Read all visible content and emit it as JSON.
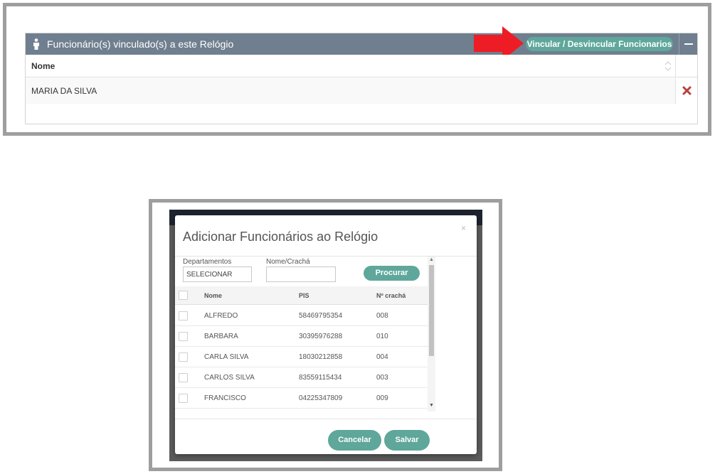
{
  "panel": {
    "title": "Funcionário(s) vinculado(s) a este Relógio",
    "vincular_button": "Vincular / Desvincular Funcionarios",
    "table": {
      "column_name": "Nome",
      "rows": [
        {
          "nome": "MARIA DA SILVA"
        }
      ]
    }
  },
  "modal": {
    "title": "Adicionar Funcionários ao Relógio",
    "close_label": "×",
    "filters": {
      "departamentos_label": "Departamentos",
      "departamentos_value": "SELECIONAR",
      "nome_label": "Nome/Crachá",
      "nome_value": ""
    },
    "procurar_button": "Procurar",
    "grid": {
      "headers": {
        "nome": "Nome",
        "pis": "PIS",
        "cracha": "Nº crachá"
      },
      "rows": [
        {
          "nome": "ALFREDO",
          "pis": "58469795354",
          "cracha": "008"
        },
        {
          "nome": "BARBARA",
          "pis": "30395976288",
          "cracha": "010"
        },
        {
          "nome": "CARLA SILVA",
          "pis": "18030212858",
          "cracha": "004"
        },
        {
          "nome": "CARLOS SILVA",
          "pis": "83559115434",
          "cracha": "003"
        },
        {
          "nome": "FRANCISCO",
          "pis": "04225347809",
          "cracha": "009"
        }
      ]
    },
    "cancelar_button": "Cancelar",
    "salvar_button": "Salvar"
  },
  "colors": {
    "header_bg": "#6f7f8f",
    "accent_teal": "#5fa79a",
    "arrow_red": "#ee1c24",
    "delete_red": "#b8433e"
  },
  "icons": [
    "user-icon",
    "sort-icon",
    "delete-icon",
    "arrow-icon",
    "minus-icon",
    "close-icon"
  ]
}
